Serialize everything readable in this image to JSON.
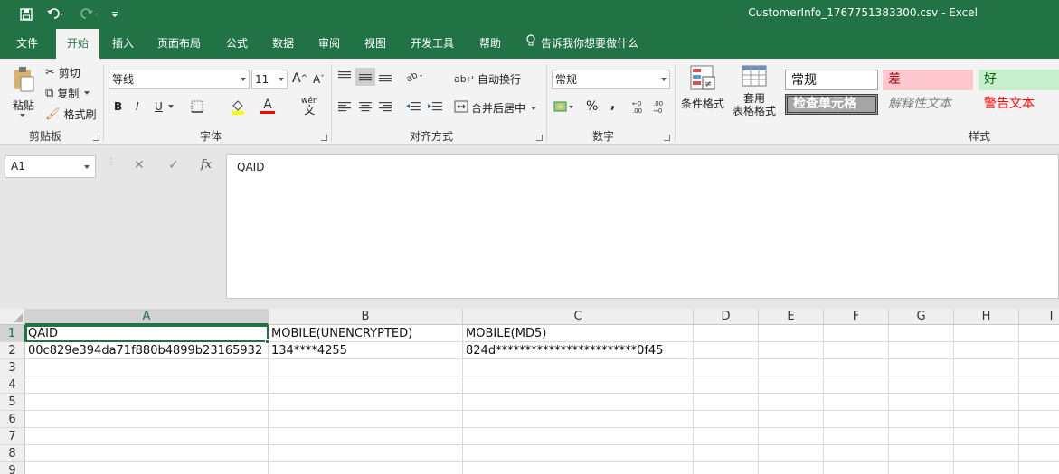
{
  "window": {
    "title": "CustomerInfo_1767751383300.csv  -  Excel",
    "accent": "#217346"
  },
  "quick_access": {
    "save_icon": "save-icon",
    "undo_icon": "undo-icon",
    "redo_icon": "redo-icon",
    "customize_icon": "customize-quick-access-icon"
  },
  "tabs": [
    "文件",
    "开始",
    "插入",
    "页面布局",
    "公式",
    "数据",
    "审阅",
    "视图",
    "开发工具",
    "帮助"
  ],
  "active_tab": "开始",
  "tell_me": "告诉我你想要做什么",
  "ribbon": {
    "clipboard": {
      "paste": "粘贴",
      "cut": "剪切",
      "copy": "复制",
      "format_painter": "格式刷",
      "label": "剪贴板"
    },
    "font": {
      "name": "等线",
      "size": "11",
      "bold": "B",
      "italic": "I",
      "underline": "U",
      "label": "字体",
      "highlight_color": "#ffff00",
      "font_color": "#ff0000"
    },
    "alignment": {
      "wrap": "自动换行",
      "merge": "合并后居中",
      "label": "对齐方式"
    },
    "number": {
      "format": "常规",
      "percent": "%",
      "comma": ",",
      "label": "数字"
    },
    "styles": {
      "conditional": "条件格式",
      "table_line1": "套用",
      "table_line2": "表格格式",
      "normal": "常规",
      "bad": "差",
      "good": "好",
      "check_cell": "检查单元格",
      "explanatory": "解释性文本",
      "warning": "警告文本",
      "label": "样式"
    }
  },
  "formula_bar": {
    "name_box": "A1",
    "cancel": "✕",
    "enter": "✓",
    "fx": "fx",
    "content": "QAID"
  },
  "sheet": {
    "columns": [
      "A",
      "B",
      "C",
      "D",
      "E",
      "F",
      "G",
      "H",
      "I"
    ],
    "rows": [
      "1",
      "2",
      "3",
      "4",
      "5",
      "6",
      "7",
      "8",
      "9"
    ],
    "cells": {
      "A1": "QAID",
      "B1": "MOBILE(UNENCRYPTED)",
      "C1": "MOBILE(MD5)",
      "A2": "00c829e394da71f880b4899b23165932",
      "B2": "134****4255",
      "C2": "824d************************0f45"
    }
  }
}
